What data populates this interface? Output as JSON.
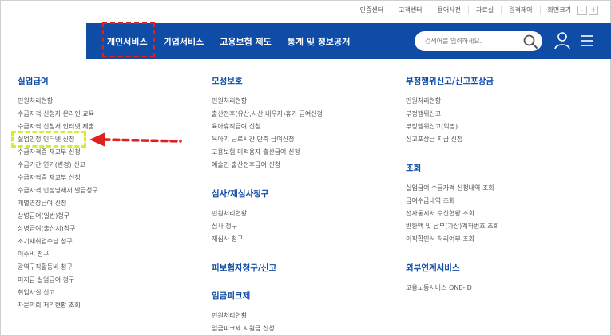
{
  "utility": {
    "links": [
      "인증센터",
      "고객센터",
      "용어사전",
      "자료실",
      "원격제어",
      "화면크기"
    ],
    "zoom_out": "-",
    "zoom_in": "+"
  },
  "nav": {
    "items": [
      "개인서비스",
      "기업서비스",
      "고용보험 제도",
      "통계 및 정보공개"
    ],
    "search_placeholder": "검색어를 입력하세요.",
    "color": "#0e4ca6"
  },
  "menu": {
    "col1": {
      "heading": "실업급여",
      "items": [
        "민원처리현황",
        "수급자격 신청자 온라인 교육",
        "수급자격 신청서 인터넷 제출",
        "실업인정 인터넷 신청",
        "수급자격증 재교부 신청",
        "수급기간 연기(변경) 신고",
        "수급자격증 재교부 신청",
        "수급자격 인정명세서 발급청구",
        "개별연장급여 신청",
        "상병급여(일반)청구",
        "상병급여(출산시)청구",
        "조기재취업수당 청구",
        "이주비 청구",
        "광역구직활동비 청구",
        "미지급 실업급여 청구",
        "취업사실 신고",
        "자문의뢰 처리현황 조회"
      ]
    },
    "col2": {
      "sections": [
        {
          "heading": "모성보호",
          "items": [
            "민원처리현황",
            "출산전후(유산,사산,배우자)휴가 급여신청",
            "육아휴직급여 신청",
            "육아기 근로시간 단축 급여신청",
            "고용보험 미적용자 출산급여 신청",
            "예술인 출산전후급여 신청"
          ]
        },
        {
          "heading": "심사/재심사청구",
          "items": [
            "민원처리현황",
            "심사 청구",
            "재심사 청구"
          ]
        },
        {
          "heading": "피보험자청구/신고",
          "items": []
        },
        {
          "heading": "임금피크제",
          "items": [
            "민원처리현황",
            "임금피크제 지원금 신청"
          ]
        }
      ]
    },
    "col3": {
      "sections": [
        {
          "heading": "부정행위신고/신고포상금",
          "items": [
            "민원처리현황",
            "부정행위신고",
            "부정행위신고(익명)",
            "신고포상금 지급 신청"
          ]
        },
        {
          "heading": "조회",
          "items": [
            "실업급여 수급자격 신청내역 조회",
            "급여수급내역 조회",
            "전자통지서 수신현황 조회",
            "반환액 및 납부(가상)계좌번호 조회",
            "이직확인서 처리여부 조회"
          ]
        },
        {
          "heading": "외부연계서비스",
          "items": [
            "고용노동서비스 ONE-ID"
          ]
        }
      ]
    }
  },
  "annotation_colors": {
    "red": "#e02020",
    "yellow": "#d8ec2a"
  }
}
